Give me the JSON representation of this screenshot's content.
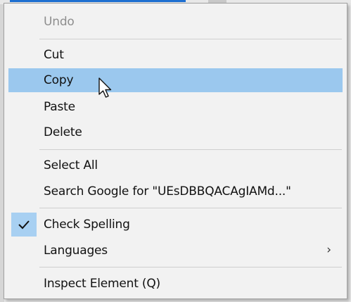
{
  "menu": {
    "items": [
      {
        "id": "undo",
        "label": "Undo",
        "enabled": false
      },
      {
        "id": "cut",
        "label": "Cut",
        "enabled": true
      },
      {
        "id": "copy",
        "label": "Copy",
        "enabled": true,
        "highlighted": true
      },
      {
        "id": "paste",
        "label": "Paste",
        "enabled": true
      },
      {
        "id": "delete",
        "label": "Delete",
        "enabled": true
      },
      {
        "id": "select-all",
        "label": "Select All",
        "enabled": true
      },
      {
        "id": "search-google",
        "label": "Search Google for \"UEsDBBQACAgIAMd...\"",
        "enabled": true
      },
      {
        "id": "check-spelling",
        "label": "Check Spelling",
        "enabled": true,
        "checked": true
      },
      {
        "id": "languages",
        "label": "Languages",
        "enabled": true,
        "submenu": true
      },
      {
        "id": "inspect-element",
        "label": "Inspect Element (Q)",
        "enabled": true
      }
    ],
    "submenu_indicator": "›"
  },
  "colors": {
    "highlight": "#9bc8ee",
    "check_background": "#a8d0f2",
    "disabled_text": "#8e8e8e"
  },
  "icons": {
    "check": "check-icon",
    "cursor": "mouse-pointer-icon",
    "submenu": "chevron-right-icon"
  }
}
